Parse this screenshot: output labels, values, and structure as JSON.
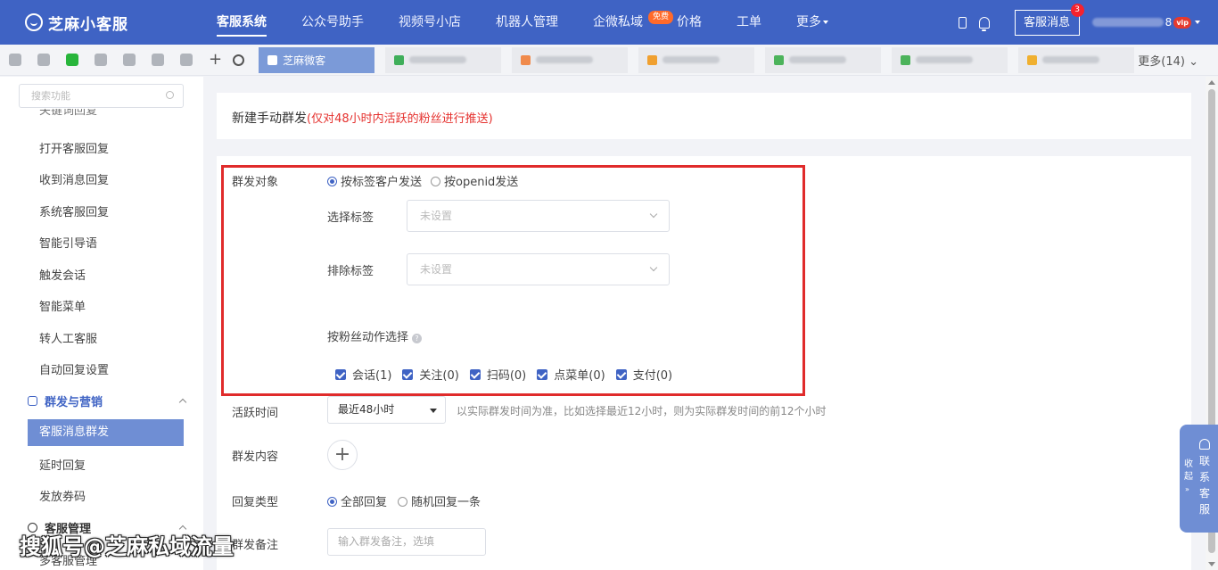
{
  "app": {
    "name": "芝麻小客服"
  },
  "nav": {
    "items": [
      "客服系统",
      "公众号助手",
      "视频号小店",
      "机器人管理",
      "企微私域",
      "价格",
      "工单",
      "更多"
    ],
    "free_badge": "免费"
  },
  "topbar": {
    "message_button": "客服消息",
    "message_count": "3",
    "user_digit": "8",
    "vip": "vip"
  },
  "tabs": {
    "active": "芝麻微客",
    "more": "更多(14)"
  },
  "sidebar": {
    "search_placeholder": "搜索功能",
    "cut_item": "关键词回复",
    "items_a": [
      "打开客服回复",
      "收到消息回复",
      "系统客服回复",
      "智能引导语",
      "触发会话",
      "智能菜单",
      "转人工客服",
      "自动回复设置"
    ],
    "section_marketing": "群发与营销",
    "active_item": "客服消息群发",
    "items_b": [
      "延时回复",
      "发放券码"
    ],
    "section_service": "客服管理",
    "items_c": [
      "多客服管理"
    ]
  },
  "page": {
    "title": "新建手动群发",
    "note": "(仅对48小时内活跃的粉丝进行推送)"
  },
  "form": {
    "target_label": "群发对象",
    "target_options": [
      "按标签客户发送",
      "按openid发送"
    ],
    "select_tag_label": "选择标签",
    "select_tag_placeholder": "未设置",
    "exclude_tag_label": "排除标签",
    "exclude_tag_placeholder": "未设置",
    "fan_action_label": "按粉丝动作选择",
    "fan_actions": [
      "会话(1)",
      "关注(0)",
      "扫码(0)",
      "点菜单(0)",
      "支付(0)"
    ],
    "active_time_label": "活跃时间",
    "active_time_value": "最近48小时",
    "active_time_hint": "以实际群发时间为准，比如选择最近12小时，则为实际群发时间的前12个小时",
    "content_label": "群发内容",
    "add_symbol": "+",
    "reply_type_label": "回复类型",
    "reply_options": [
      "全部回复",
      "随机回复一条"
    ],
    "note_label": "群发备注",
    "note_placeholder": "输入群发备注，选填"
  },
  "float": {
    "collapse": "收起",
    "arrows": "»",
    "contact": "联系客服"
  },
  "watermark": "搜狐号@芝麻私域流量",
  "colors": {
    "primary": "#3f63c4",
    "accent": "#6f8ed4",
    "highlight_box": "#e02b2b",
    "note_red": "#e5312e"
  }
}
